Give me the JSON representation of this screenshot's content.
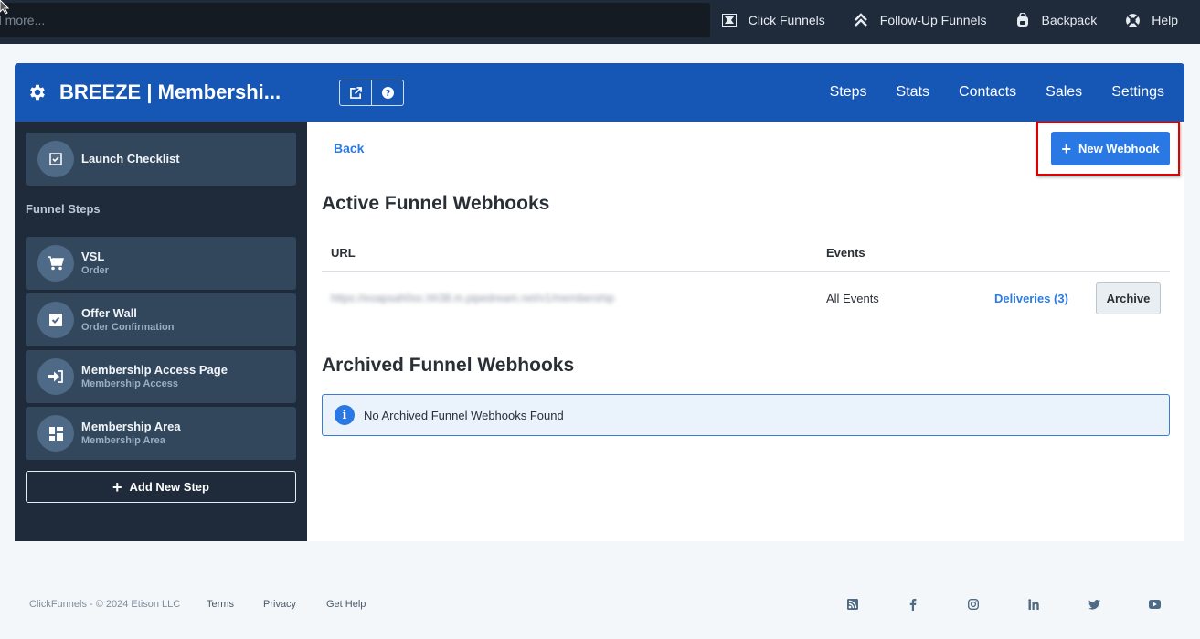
{
  "topbar": {
    "search_placeholder": "Find more...",
    "search_visible_text": "d more...",
    "nav": [
      {
        "label": "Click Funnels",
        "icon": "clickfunnels-logo-icon"
      },
      {
        "label": "Follow-Up Funnels",
        "icon": "double-chevron-up-icon"
      },
      {
        "label": "Backpack",
        "icon": "backpack-icon"
      },
      {
        "label": "Help",
        "icon": "lifebuoy-icon"
      }
    ]
  },
  "header": {
    "title": "BREEZE | Membershi...",
    "actions": [
      {
        "icon": "external-edit-icon"
      },
      {
        "icon": "question-circle-icon"
      }
    ],
    "nav": [
      "Steps",
      "Stats",
      "Contacts",
      "Sales",
      "Settings"
    ],
    "colors": {
      "header_bg": "#1656b5",
      "accent": "#2a78e4"
    }
  },
  "sidebar": {
    "launch_checklist": "Launch Checklist",
    "heading": "Funnel Steps",
    "steps": [
      {
        "name": "VSL",
        "type": "Order",
        "icon": "cart-icon"
      },
      {
        "name": "Offer Wall",
        "type": "Order Confirmation",
        "icon": "check-square-icon"
      },
      {
        "name": "Membership Access Page",
        "type": "Membership Access",
        "icon": "sign-in-icon"
      },
      {
        "name": "Membership Area",
        "type": "Membership Area",
        "icon": "dashboard-icon"
      }
    ],
    "add_step_label": "Add New Step"
  },
  "content": {
    "back_label": "Back",
    "new_webhook_label": "New Webhook",
    "active_title": "Active Funnel Webhooks",
    "table": {
      "headers": [
        "URL",
        "Events"
      ],
      "rows": [
        {
          "url": "https://eoapsah0oc.hh38.m.pipedream.net/v1/membership",
          "events": "All Events",
          "deliveries": "Deliveries (3)",
          "archive": "Archive"
        }
      ]
    },
    "archived_title": "Archived Funnel Webhooks",
    "archived_empty": "No Archived Funnel Webhooks Found"
  },
  "footer": {
    "copyright": "ClickFunnels - © 2024 Etison LLC",
    "links": [
      "Terms",
      "Privacy",
      "Get Help"
    ],
    "social": [
      "rss-icon",
      "facebook-icon",
      "instagram-icon",
      "linkedin-icon",
      "twitter-icon",
      "youtube-icon"
    ]
  }
}
